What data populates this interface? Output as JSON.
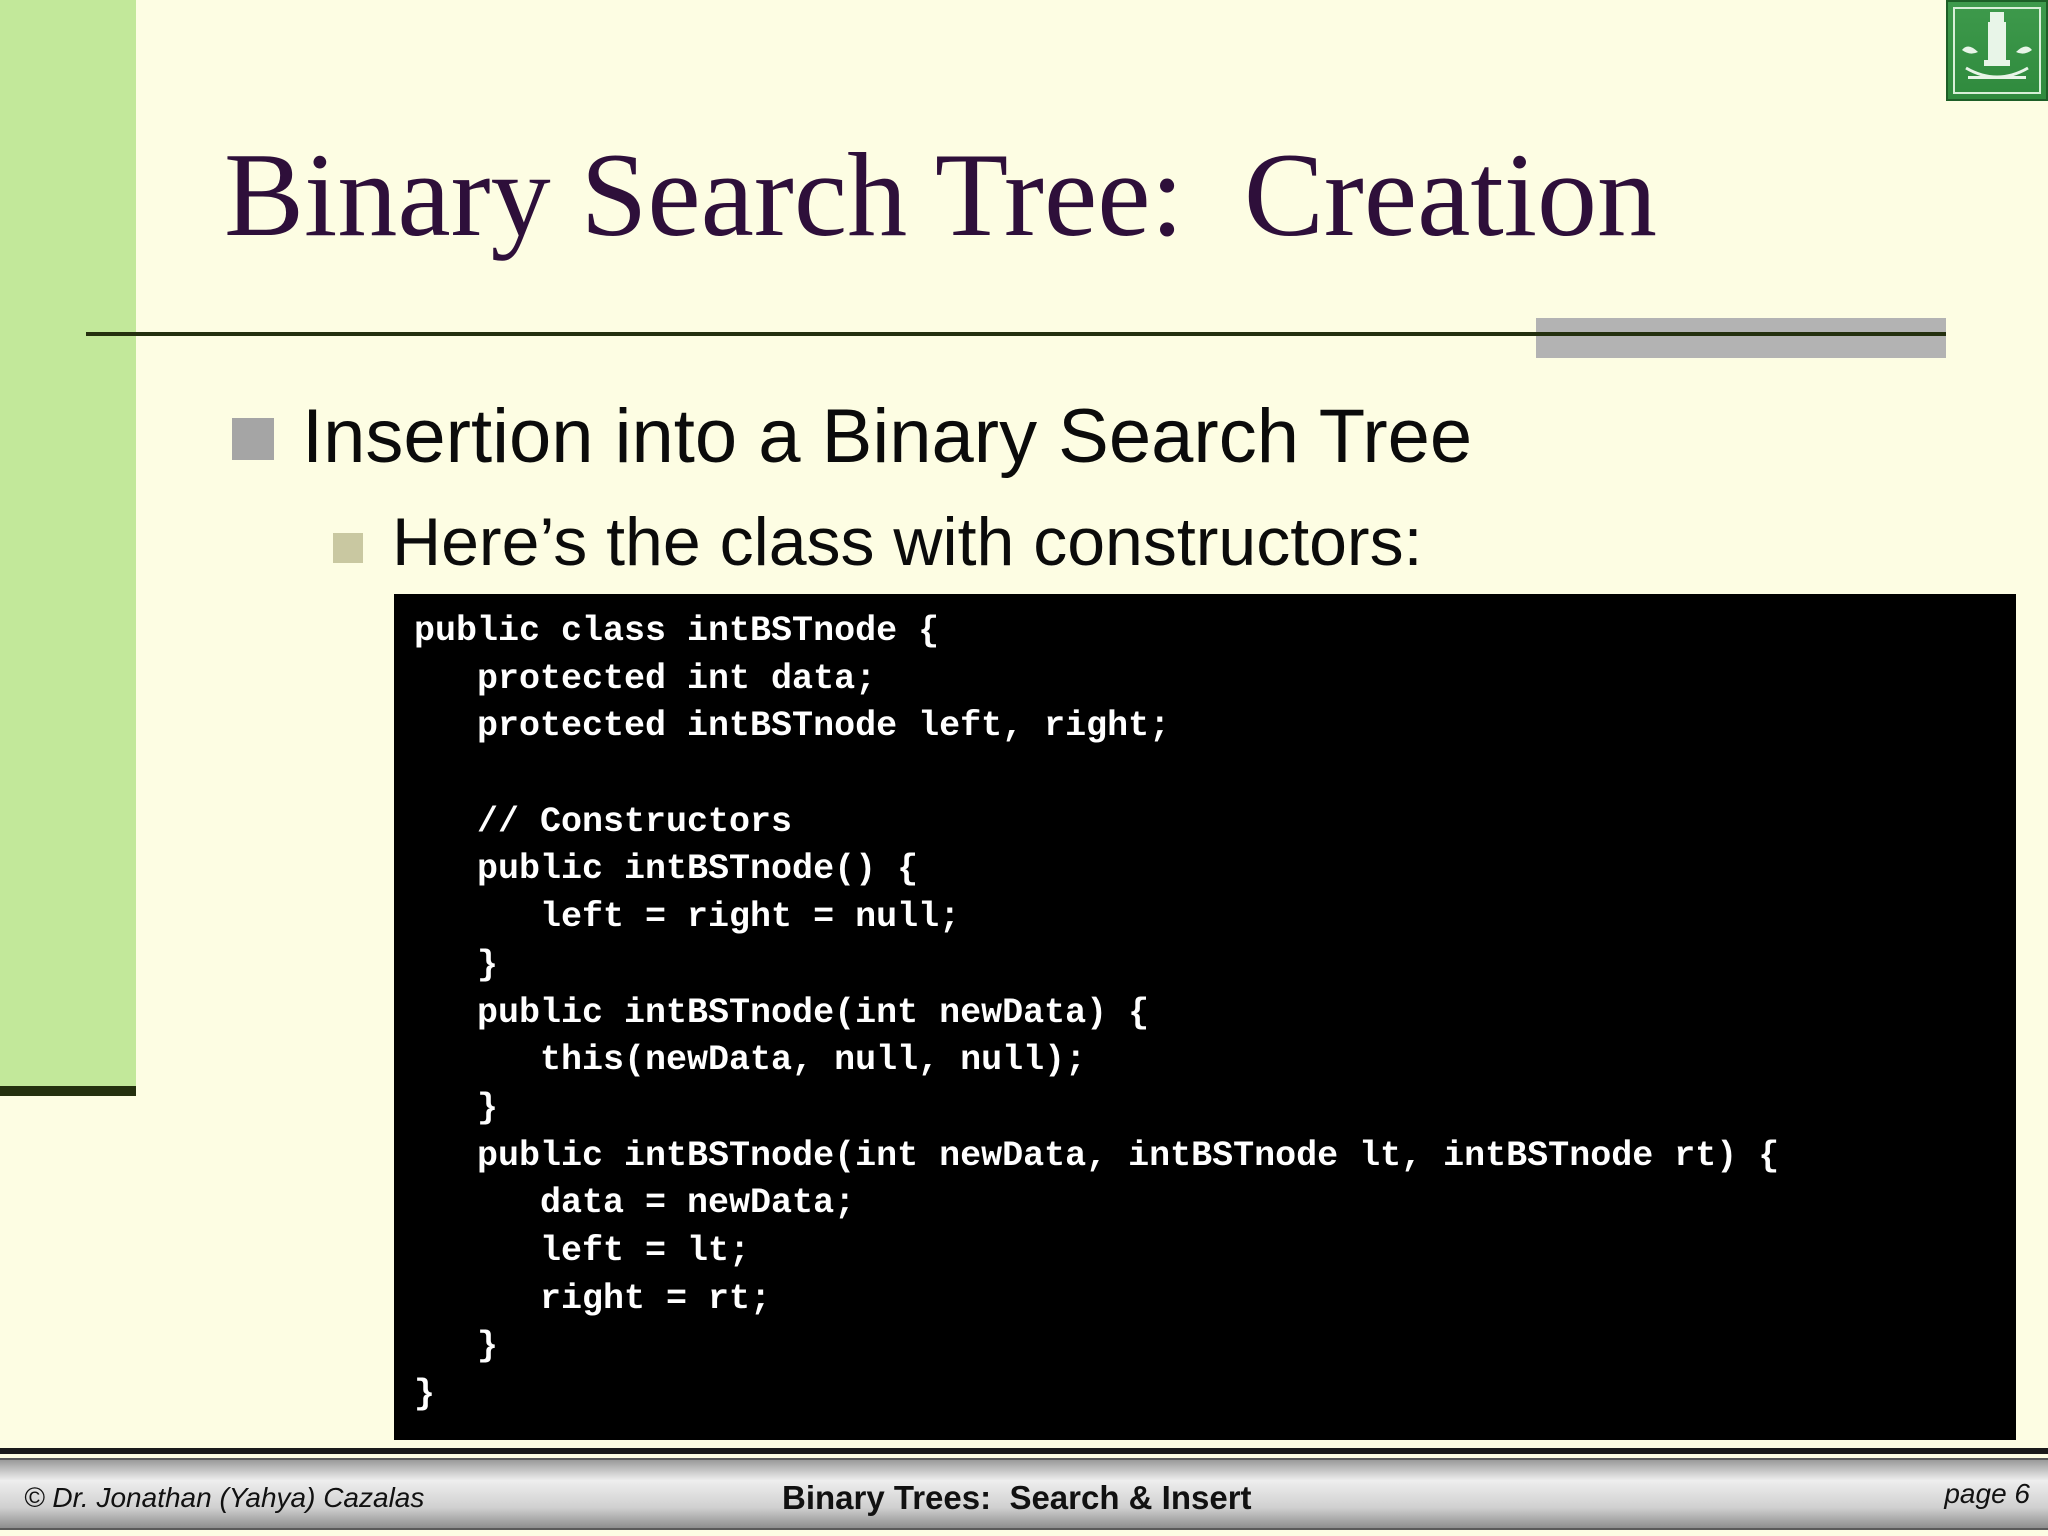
{
  "slide": {
    "title": "Binary Search Tree:  Creation",
    "bullet_level1": "Insertion into a Binary Search Tree",
    "bullet_level2": "Here’s the class with constructors:",
    "logo_icon": "university-seal-icon",
    "bullet_icons": [
      "square-bullet-icon",
      "square-bullet-icon"
    ]
  },
  "code": {
    "lines": [
      "public class intBSTnode {",
      "   protected int data;",
      "   protected intBSTnode left, right;",
      "",
      "   // Constructors",
      "   public intBSTnode() {",
      "      left = right = null;",
      "   }",
      "   public intBSTnode(int newData) {",
      "      this(newData, null, null);",
      "   }",
      "   public intBSTnode(int newData, intBSTnode lt, intBSTnode rt) {",
      "      data = newData;",
      "      left = lt;",
      "      right = rt;",
      "   }",
      "}"
    ]
  },
  "footer": {
    "author": "© Dr. Jonathan (Yahya) Cazalas",
    "course_topic": "Binary Trees:  Search & Insert",
    "page_label": "page 6"
  },
  "colors": {
    "background": "#fdfde3",
    "left_bar": "#c2e89a",
    "title": "#2e0f3a",
    "code_background": "#000000",
    "code_text": "#ffffff"
  }
}
